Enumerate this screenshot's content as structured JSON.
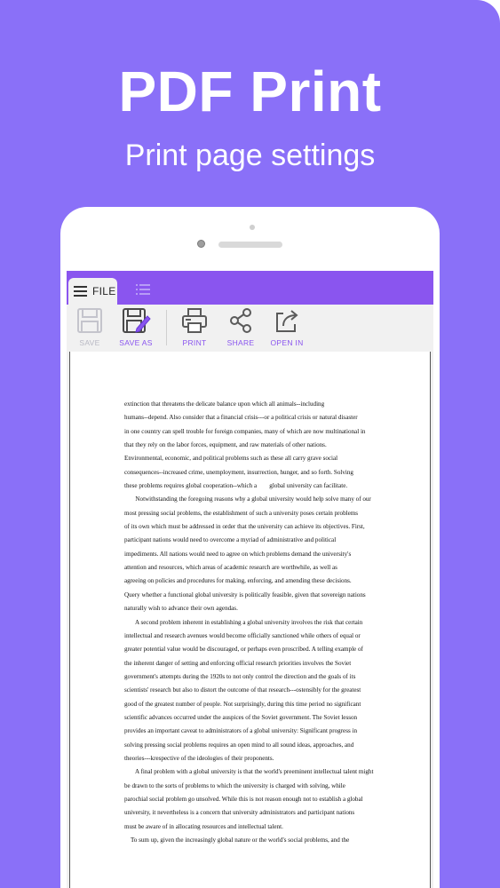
{
  "header": {
    "title": "PDF Print",
    "subtitle": "Print page settings"
  },
  "app": {
    "tabs": {
      "file_label": "FILE"
    },
    "toolbar": {
      "save": "SAVE",
      "save_as": "SAVE AS",
      "print": "PRINT",
      "share": "SHARE",
      "open_in": "OPEN IN"
    },
    "accent_color": "#8a55ef",
    "background_color": "#8a70f8"
  },
  "document": {
    "lines": [
      "extinction that threatens the delicate balance upon which all animals--including",
      "humans--depend. Also consider that a financial crisis---or a political crisis or natural disaster",
      "in one country can spell trouble for foreign companies, many of which are now multinational in",
      "that they rely on the labor forces, equipment, and raw materials of other nations.",
      "Environmental, economic, and political problems such as these all carry grave social",
      "consequences--increased crime, unemployment, insurrection, hunger, and so forth. Solving",
      "these problems requires global cooperation--which a        global university can facilitate.",
      "       Notwithstanding the foregoing reasons why a global university would help solve many of our",
      "most pressing social problems, the establishment of such a university poses certain problems",
      "of its own which must be addressed in order that the university can achieve its objectives. First,",
      "participant nations would need to overcome a myriad of administrative and political",
      "impediments. All nations would need to agree on which problems demand the university's",
      "attention and resources, which areas of academic research are worthwhile, as well as",
      "agreeing on policies and procedures for making, enforcing, and amending these decisions.",
      "Query whether a functional global university is politically feasible, given that sovereign nations",
      "naturally wish to advance their own agendas.",
      "       A second problem inherent in establishing a global university involves the risk that certain",
      "intellectual and research avenues would become officially sanctioned while others of equal or",
      "greater potential value would be discouraged, or perhaps even proscribed. A telling example of",
      "the inherent danger of setting and enforcing official research priorities involves the Soviet",
      "government's attempts during the 1920s to not only control the direction and the goals of its",
      "scientists' research but also to distort the outcome of that research---ostensibly for the greatest",
      "good of the greatest number of people. Not surprisingly, during this time period no significant",
      "scientific advances occurred under the auspices of the Soviet government. The Soviet lesson",
      "provides an important caveat to administrators of a global university: Significant progress in",
      "solving pressing social problems requires an open mind to all sound ideas, approaches, and",
      "theories---krespective of the ideologies of their proponents.",
      "       A final problem with a global university is that the world's preeminent intellectual talent might",
      "be drawn to the sorts of problems to which the university is charged with solving, while",
      "parochial social problem go unsolved. While this is not reason enough not to establish a global",
      "university, it nevertheless is a concern that university administrators and participant nations",
      "must be aware of in allocating resources and intellectual talent.",
      "    To sum up, given the increasingly global nature or the world's social problems, and the"
    ]
  }
}
